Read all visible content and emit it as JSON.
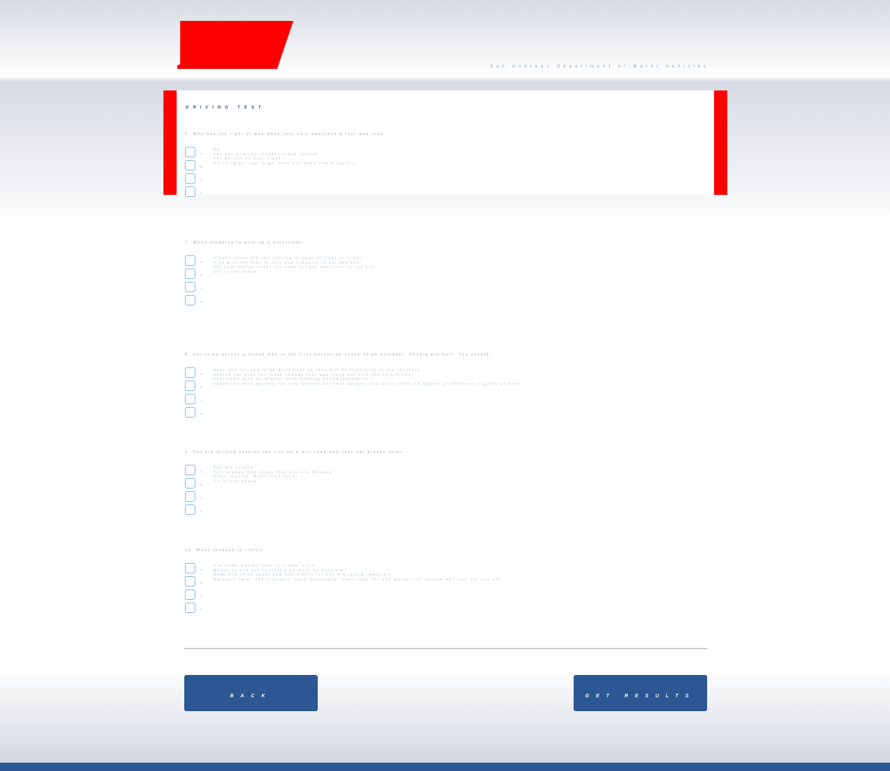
{
  "header": {
    "department": "San Andreas Department of Motor Vehicles"
  },
  "test": {
    "title": "DRIVING TEST"
  },
  "questions": [
    {
      "text": "6. Who has the right of way when four cars approach a four way stop:",
      "letters": [
        "A.",
        "B.",
        "C.",
        "D."
      ],
      "options": [
        "Me.",
        "The car with the loudest sound system.",
        "The person on your right.",
        "Go on three, tap to go, then you honk like a lunatic."
      ]
    },
    {
      "text": "7. When stopping to pick up a prostitute:",
      "letters": [
        "A.",
        "B.",
        "C.",
        "D."
      ],
      "options": [
        "Always leave the car running in case of fight or flight.",
        "Find a street that is soft and romantic to get the sex.",
        "Put your wallet under the seat in case she tries to rob you.",
        "All of the above."
      ]
    },
    {
      "text": "8. You come across a friend who is the first person on scene of an accident. People are hurt. You should:",
      "letters": [
        "A.",
        "B.",
        "C.",
        "D."
      ],
      "options": [
        "Save any fun and large girls first as they will be rewarding in the recovery.",
        "Search the area for loose change that was flung out with the cars killed.",
        "Post some pics on Bleeter with hashtag #TheRoadsOfLife.",
        "Leave the area quickly, no time wasted on these people. You don't need the hassle of whatever is going on here."
      ]
    },
    {
      "text": "9. You are driving outside the city on a dirt road and your car breaks down:",
      "letters": [
        "A.",
        "B.",
        "C.",
        "D."
      ],
      "options": [
        "You are fucked.",
        "Tell anyone that stops that you are blessed.",
        "Start running. Don't look back.",
        "All of the above."
      ]
    },
    {
      "text": "10. When stopped in traffic:",
      "letters": [
        "A.",
        "B.",
        "C.",
        "D."
      ],
      "options": [
        "Use some wasted time to create a lie.",
        "Weave in and out of traffic as much as possible.",
        "Beep and think about how bad traffic is, you are really important.",
        "Maintain calm. The city gets there eventually. Then jump out and murder the person who just cut you off."
      ]
    }
  ],
  "buttons": {
    "back": "BACK",
    "results": "GET RESULTS"
  }
}
